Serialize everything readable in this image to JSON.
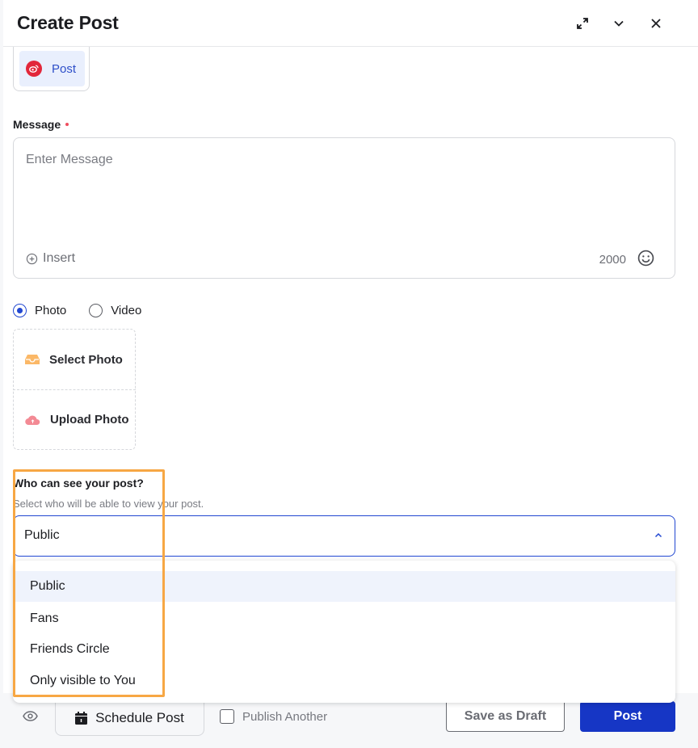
{
  "header": {
    "title": "Create Post",
    "icons": [
      "expand-icon",
      "chevron-down-icon",
      "close-icon"
    ]
  },
  "channel": {
    "label": "Post",
    "icon": "weibo-icon",
    "brand_color": "#e2263a"
  },
  "message": {
    "label": "Message",
    "required": true,
    "placeholder": "Enter Message",
    "value": "",
    "insert_label": "Insert",
    "char_count": "2000"
  },
  "media_type": {
    "options": [
      {
        "label": "Photo",
        "checked": true
      },
      {
        "label": "Video",
        "checked": false
      }
    ]
  },
  "media_actions": {
    "select_photo": "Select Photo",
    "upload_photo": "Upload Photo"
  },
  "visibility": {
    "title": "Who can see your post?",
    "subtitle": "Select who will be able to view your post.",
    "selected": "Public",
    "options": [
      "Public",
      "Fans",
      "Friends Circle",
      "Only visible to You"
    ]
  },
  "footer": {
    "schedule_label": "Schedule Post",
    "publish_another_label": "Publish Another",
    "publish_another_checked": false,
    "save_draft_label": "Save as Draft",
    "post_label": "Post"
  },
  "colors": {
    "accent": "#2147d1",
    "primary_button": "#1636c5",
    "highlight": "#f7a744",
    "required": "#ef4d5e"
  }
}
